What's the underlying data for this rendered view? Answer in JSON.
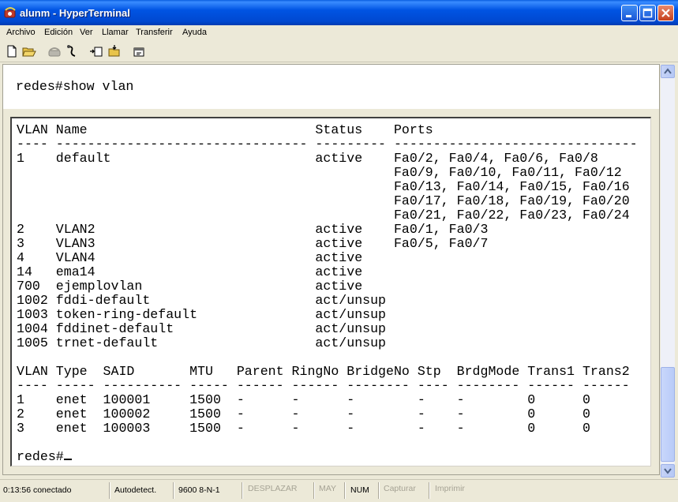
{
  "window": {
    "title": "alunm - HyperTerminal",
    "app_icon": "hyperterminal-phone-icon"
  },
  "menu": [
    "Archivo",
    "Edición",
    "Ver",
    "Llamar",
    "Transferir",
    "Ayuda"
  ],
  "toolbar": [
    "new-icon",
    "open-icon",
    "disconnect-icon",
    "connect-icon",
    "send-icon",
    "receive-icon",
    "properties-icon"
  ],
  "terminal": {
    "command_line": "redes#show vlan",
    "vlan_header": "VLAN Name                             Status    Ports",
    "vlan_sep": "---- -------------------------------- --------- -------------------------------",
    "vlan_rows": [
      "1    default                          active    Fa0/2, Fa0/4, Fa0/6, Fa0/8",
      "                                                Fa0/9, Fa0/10, Fa0/11, Fa0/12",
      "                                                Fa0/13, Fa0/14, Fa0/15, Fa0/16",
      "                                                Fa0/17, Fa0/18, Fa0/19, Fa0/20",
      "                                                Fa0/21, Fa0/22, Fa0/23, Fa0/24",
      "2    VLAN2                            active    Fa0/1, Fa0/3",
      "3    VLAN3                            active    Fa0/5, Fa0/7",
      "4    VLAN4                            active",
      "14   ema14                            active",
      "700  ejemplovlan                      active",
      "1002 fddi-default                     act/unsup",
      "1003 token-ring-default               act/unsup",
      "1004 fddinet-default                  act/unsup",
      "1005 trnet-default                    act/unsup"
    ],
    "type_header": "VLAN Type  SAID       MTU   Parent RingNo BridgeNo Stp  BrdgMode Trans1 Trans2",
    "type_sep": "---- ----- ---------- ----- ------ ------ -------- ---- -------- ------ ------",
    "type_rows": [
      "1    enet  100001     1500  -      -      -        -    -        0      0",
      "2    enet  100002     1500  -      -      -        -    -        0      0",
      "3    enet  100003     1500  -      -      -        -    -        0      0"
    ],
    "prompt": "redes#"
  },
  "status": {
    "connected": "0:13:56 conectado",
    "detect": "Autodetect.",
    "params": "9600 8-N-1",
    "scroll": "DESPLAZAR",
    "caps": "MAY",
    "num": "NUM",
    "capture": "Capturar",
    "print": "Imprimir"
  },
  "colors": {
    "titlebar": "#0054e3",
    "chrome": "#ece9d8",
    "terminal_bg": "#ffffff",
    "text": "#000000"
  }
}
